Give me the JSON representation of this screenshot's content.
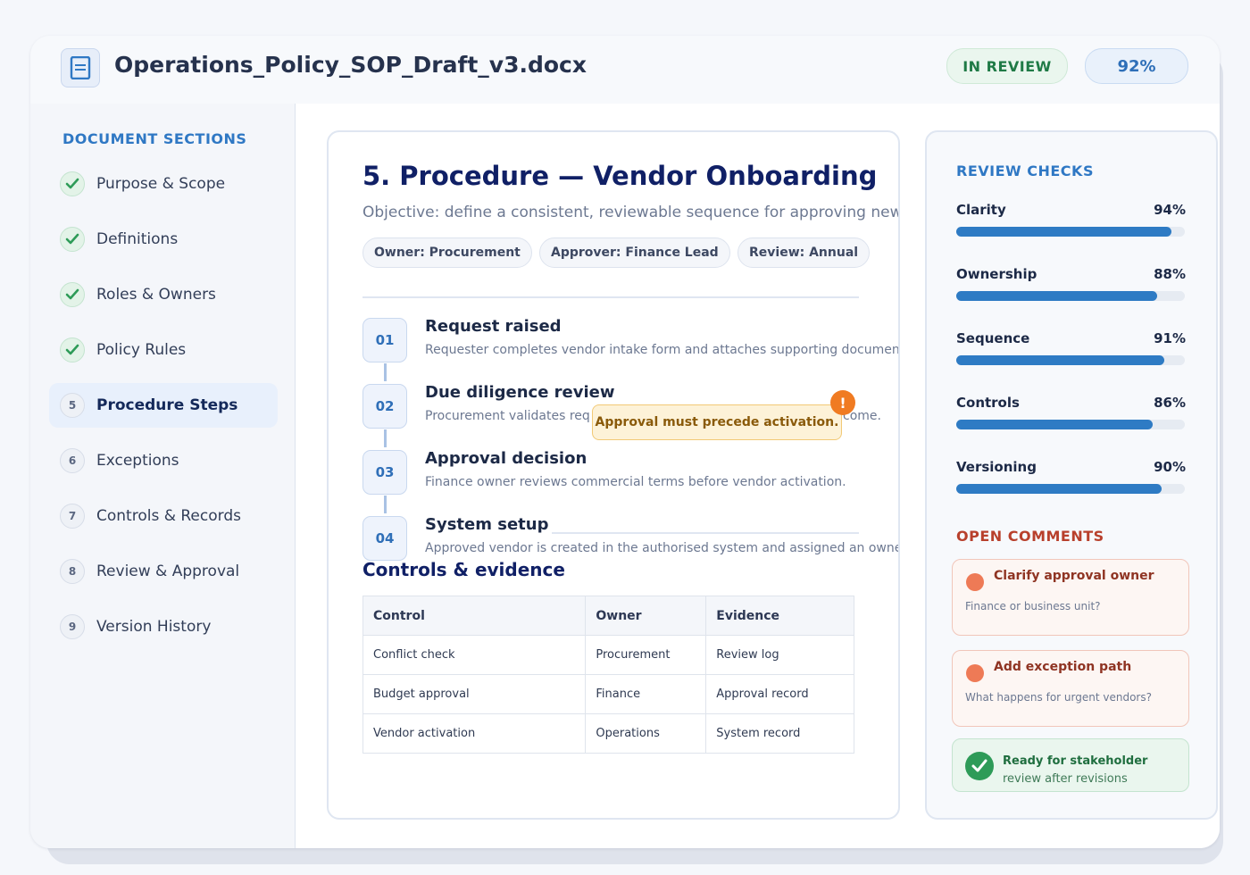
{
  "header": {
    "title": "Operations_Policy_SOP_Draft_v3.docx",
    "status_badge": "IN REVIEW",
    "score_badge": "92%"
  },
  "sidebar": {
    "title": "DOCUMENT SECTIONS",
    "items": [
      {
        "marker": "check",
        "label": "Purpose & Scope"
      },
      {
        "marker": "check",
        "label": "Definitions"
      },
      {
        "marker": "check",
        "label": "Roles & Owners"
      },
      {
        "marker": "check",
        "label": "Policy Rules"
      },
      {
        "marker": "5",
        "label": "Procedure Steps",
        "active": true
      },
      {
        "marker": "6",
        "label": "Exceptions"
      },
      {
        "marker": "7",
        "label": "Controls & Records"
      },
      {
        "marker": "8",
        "label": "Review & Approval"
      },
      {
        "marker": "9",
        "label": "Version History"
      }
    ]
  },
  "main": {
    "section_title": "5. Procedure — Vendor Onboarding",
    "objective": "Objective: define a consistent, reviewable sequence for approving new ve",
    "chips": [
      "Owner: Procurement",
      "Approver: Finance Lead",
      "Review: Annual"
    ],
    "steps": [
      {
        "num": "01",
        "title": "Request raised",
        "desc": "Requester completes vendor intake form and attaches supporting documents."
      },
      {
        "num": "02",
        "title": "Due diligence review",
        "desc": "Procurement validates req",
        "desc_tail": "come."
      },
      {
        "num": "03",
        "title": "Approval decision",
        "desc": "Finance owner reviews commercial terms before vendor activation."
      },
      {
        "num": "04",
        "title": "System setup",
        "desc": "Approved vendor is created in the authorised system and assigned an owner."
      }
    ],
    "callout": "Approval must precede activation.",
    "callout_alert": "!",
    "controls_title": "Controls & evidence",
    "table": {
      "headers": [
        "Control",
        "Owner",
        "Evidence"
      ],
      "rows": [
        [
          "Conflict check",
          "Procurement",
          "Review log"
        ],
        [
          "Budget approval",
          "Finance",
          "Approval record"
        ],
        [
          "Vendor activation",
          "Operations",
          "System record"
        ]
      ]
    }
  },
  "review": {
    "title": "REVIEW CHECKS",
    "checks": [
      {
        "label": "Clarity",
        "value": "94%",
        "fraction": 0.94
      },
      {
        "label": "Ownership",
        "value": "88%",
        "fraction": 0.88
      },
      {
        "label": "Sequence",
        "value": "91%",
        "fraction": 0.91
      },
      {
        "label": "Controls",
        "value": "86%",
        "fraction": 0.86
      },
      {
        "label": "Versioning",
        "value": "90%",
        "fraction": 0.9
      }
    ],
    "comments_title": "OPEN COMMENTS",
    "comments": [
      {
        "title": "Clarify approval owner",
        "text": "Finance or business unit?"
      },
      {
        "title": "Add exception path",
        "text": "What happens for urgent vendors?"
      }
    ],
    "ready": {
      "title": "Ready for stakeholder",
      "subtitle": "review after revisions"
    }
  },
  "colors": {
    "accent": "#2f78c4",
    "title_navy": "#102066",
    "success": "#2e9b58",
    "warning": "#f07b22",
    "comment": "#ee7a56"
  },
  "icons": {
    "document": "document-icon",
    "section_done": "check-icon",
    "alert": "alert-icon",
    "comment": "comment-dot-icon",
    "ready": "check-circle-icon"
  }
}
